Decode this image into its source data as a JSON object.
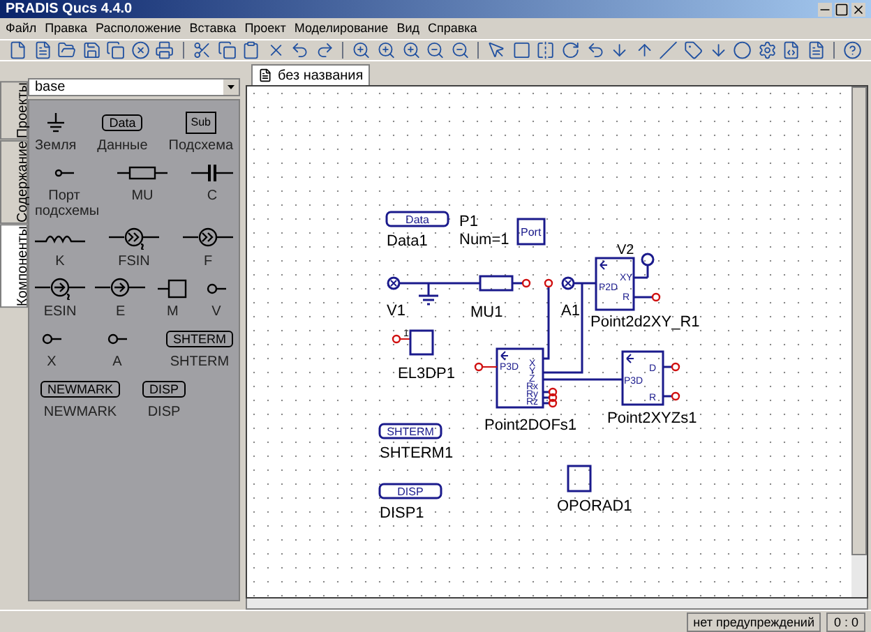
{
  "window": {
    "title": "PRADIS Qucs 4.4.0"
  },
  "menu": [
    "Файл",
    "Правка",
    "Расположение",
    "Вставка",
    "Проект",
    "Моделирование",
    "Вид",
    "Справка"
  ],
  "side_tabs": [
    {
      "label": "Проекты",
      "selected": false
    },
    {
      "label": "Содержание",
      "selected": false
    },
    {
      "label": "Компоненты",
      "selected": true
    }
  ],
  "library_select": {
    "value": "base"
  },
  "palette_rows": [
    [
      {
        "kind": "ground",
        "label": "Земля"
      },
      {
        "kind": "block",
        "symbol": "Data",
        "label": "Данные"
      },
      {
        "kind": "sub",
        "symbol": "Sub",
        "label": "Подсхема"
      }
    ],
    [
      {
        "kind": "port",
        "label": "Порт подсхемы"
      },
      {
        "kind": "resistor",
        "label": "MU"
      },
      {
        "kind": "capacitor",
        "label": "C"
      }
    ],
    [
      {
        "kind": "inductor",
        "label": "K"
      },
      {
        "kind": "sine_source",
        "label": "FSIN"
      },
      {
        "kind": "source",
        "label": "F"
      }
    ],
    [
      {
        "kind": "sine_arrow",
        "label": "ESIN"
      },
      {
        "kind": "arrow_source",
        "label": "E"
      },
      {
        "kind": "square",
        "label": "M"
      },
      {
        "kind": "probe",
        "label": "V"
      }
    ],
    [
      {
        "kind": "probe",
        "label": "X"
      },
      {
        "kind": "probe",
        "label": "A"
      },
      {
        "kind": "block",
        "symbol": "SHTERM",
        "label": "SHTERM"
      }
    ],
    [
      {
        "kind": "block",
        "symbol": "NEWMARK",
        "label": "NEWMARK"
      },
      {
        "kind": "block",
        "symbol": "DISP",
        "label": "DISP"
      }
    ]
  ],
  "document_tab": {
    "label": "без названия",
    "selected": true
  },
  "schematic": [
    {
      "kind": "data",
      "symbol": "Data",
      "label": "Data1"
    },
    {
      "kind": "port",
      "symbol": "Port",
      "label": "P1",
      "params": "Num=1"
    },
    {
      "kind": "probe",
      "label": "V1"
    },
    {
      "kind": "resistor",
      "label": "MU1"
    },
    {
      "kind": "probe",
      "label": "A1"
    },
    {
      "kind": "point2d",
      "label": "Point2d2XY_R1",
      "params": "V2",
      "pins": [
        "P2D",
        "XY",
        "R"
      ]
    },
    {
      "kind": "square",
      "label": "EL3DP1",
      "pins": [
        "1"
      ]
    },
    {
      "kind": "dofs",
      "label": "Point2DOFs1",
      "pins": [
        "P3D",
        "X",
        "Y",
        "Z",
        "Rx",
        "Ry",
        "Rz"
      ]
    },
    {
      "kind": "xyzs",
      "label": "Point2XYZs1",
      "pins": [
        "P3D",
        "D",
        "R"
      ]
    },
    {
      "kind": "data",
      "symbol": "SHTERM",
      "label": "SHTERM1"
    },
    {
      "kind": "data",
      "symbol": "DISP",
      "label": "DISP1"
    },
    {
      "kind": "square",
      "label": "OPORAD1"
    }
  ],
  "status_bar": {
    "message": "нет предупреждений",
    "position": "0 : 0"
  }
}
